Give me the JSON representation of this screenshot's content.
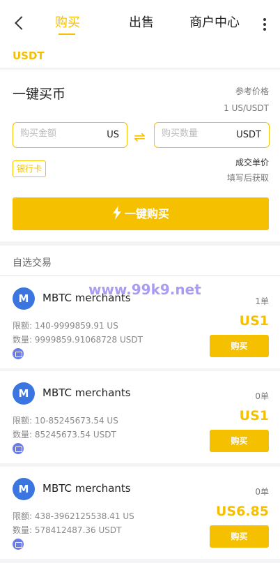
{
  "nav": {
    "tabs": [
      {
        "label": "购买",
        "active": true
      },
      {
        "label": "出售",
        "active": false
      },
      {
        "label": "商户中心",
        "active": false
      }
    ]
  },
  "coin": "USDT",
  "quick_buy": {
    "title": "一键买币",
    "ref_price_label": "参考价格",
    "ref_price_value": "1 US/USDT",
    "amount_placeholder": "购买金额",
    "amount_unit": "US",
    "qty_placeholder": "购买数量",
    "qty_unit": "USDT",
    "payment_method": "银行卡",
    "deal_price_label": "成交单价",
    "deal_price_note": "填写后获取",
    "button_label": "一键购买"
  },
  "section_title": "自选交易",
  "watermark": "www.99k9.net",
  "offers": [
    {
      "avatar": "M",
      "merchant": "MBTC merchants",
      "orders": "1单",
      "limit": "限额: 140-9999859.91 US",
      "quantity": "数量: 9999859.91068728 USDT",
      "price": "US1",
      "buy_label": "购买"
    },
    {
      "avatar": "M",
      "merchant": "MBTC merchants",
      "orders": "0单",
      "limit": "限额: 10-85245673.54 US",
      "quantity": "数量: 85245673.54 USDT",
      "price": "US1",
      "buy_label": "购买"
    },
    {
      "avatar": "M",
      "merchant": "MBTC merchants",
      "orders": "0单",
      "limit": "限额: 438-3962125538.41 US",
      "quantity": "数量: 578412487.36 USDT",
      "price": "US6.85",
      "buy_label": "购买"
    }
  ],
  "colors": {
    "accent": "#f5c000",
    "avatar": "#3a75e0",
    "payment_icon": "#6b7ce6"
  }
}
